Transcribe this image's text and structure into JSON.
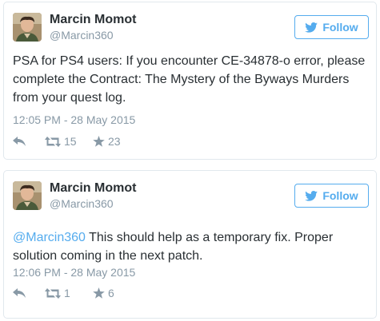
{
  "tweets": [
    {
      "author": {
        "display_name": "Marcin Momot",
        "screen_name": "@Marcin360"
      },
      "follow_label": "Follow",
      "text": "PSA for PS4 users: If you encounter CE-34878-o error, please complete the Contract: The Mystery of the Byways Murders from your quest log.",
      "mention": "",
      "timestamp": "12:05 PM - 28 May 2015",
      "retweets": "15",
      "favorites": "23"
    },
    {
      "author": {
        "display_name": "Marcin Momot",
        "screen_name": "@Marcin360"
      },
      "follow_label": "Follow",
      "mention": "@Marcin360",
      "text": " This should help as a temporary fix. Proper solution coming in the next patch.",
      "timestamp": "12:06 PM - 28 May 2015",
      "retweets": "1",
      "favorites": "6"
    }
  ],
  "colors": {
    "accent": "#55acee",
    "muted": "#8899a6",
    "text": "#292f33",
    "border": "#e1e8ed"
  },
  "icons": [
    "avatar",
    "twitter-bird-icon",
    "reply-icon",
    "retweet-icon",
    "favorite-star-icon"
  ]
}
